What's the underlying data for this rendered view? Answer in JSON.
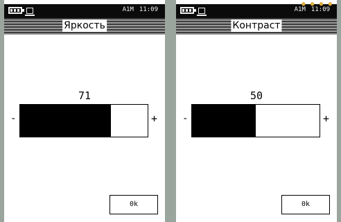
{
  "screens": [
    {
      "status": {
        "mode": "A1M",
        "time": "11:09"
      },
      "title": "Яркость",
      "value": "71",
      "level_percent": 71,
      "minus_label": "-",
      "plus_label": "+",
      "ok_label": "0k"
    },
    {
      "status": {
        "mode": "A1M",
        "time": "11:09"
      },
      "title": "Контраст",
      "value": "50",
      "level_percent": 50,
      "minus_label": "-",
      "plus_label": "+",
      "ok_label": "0k"
    }
  ],
  "icons": {
    "battery": "battery-icon",
    "folder": "folder-icon",
    "indicator": "indicator-dots-icon"
  },
  "colors": {
    "background": "#9aa59e",
    "statusbar": "#0b0b0b",
    "fill": "#000000",
    "indicator": "#e0b040"
  }
}
